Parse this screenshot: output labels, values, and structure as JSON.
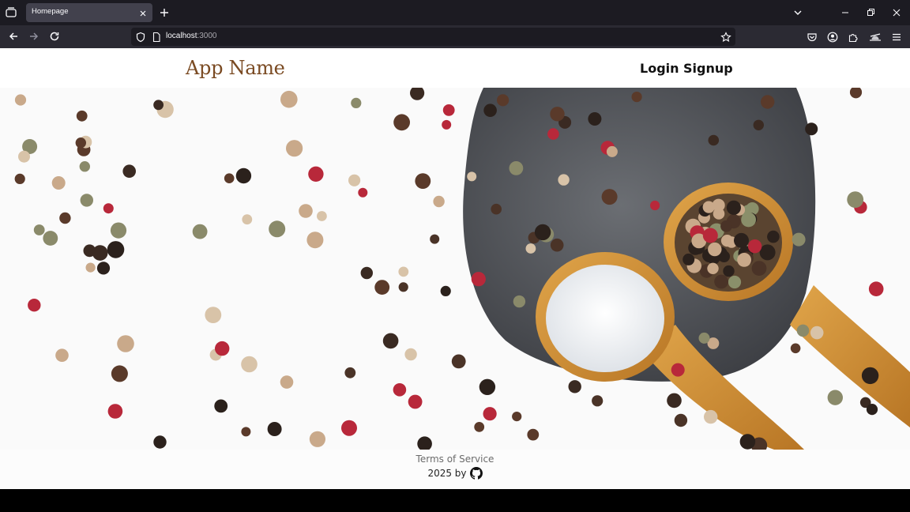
{
  "browser": {
    "tab_title": "Homepage",
    "url_host": "localhost",
    "url_port": ":3000"
  },
  "site": {
    "brand": "App Name",
    "nav": {
      "login": "Login",
      "signup": "Signup"
    },
    "footer": {
      "terms": "Terms of Service",
      "credit": "2025 by"
    }
  },
  "hero": {
    "image": "peppercorns-and-salt-on-slate-with-wooden-spoons"
  }
}
